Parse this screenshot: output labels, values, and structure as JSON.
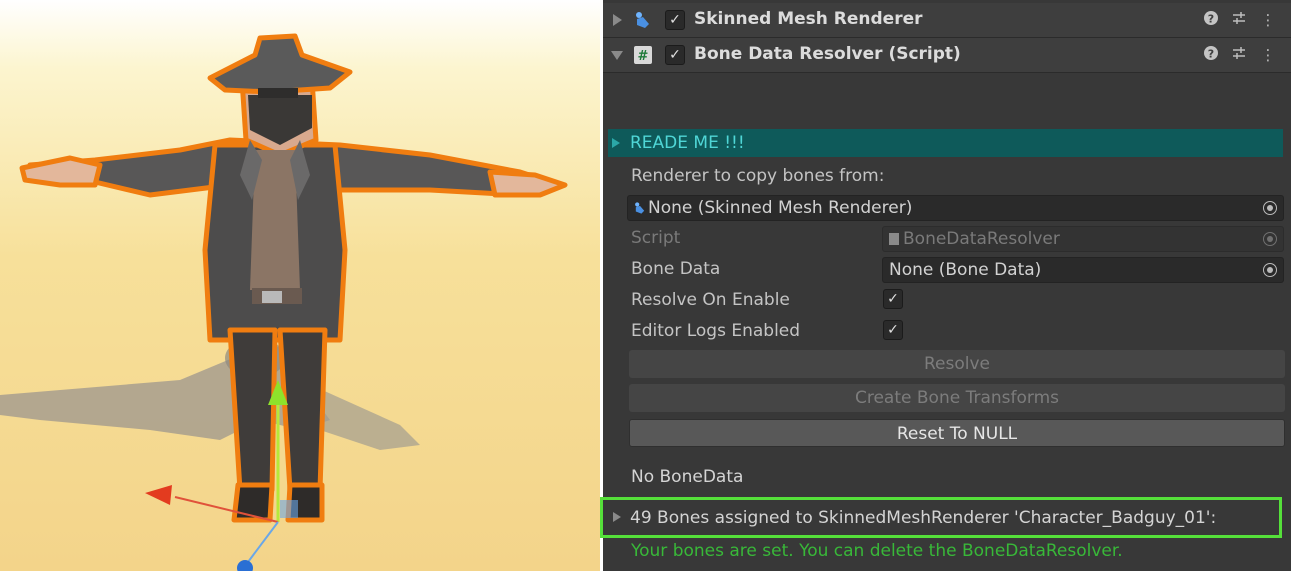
{
  "inspector": {
    "skinned_mesh_renderer": {
      "title": "Skinned Mesh Renderer"
    },
    "bone_data_resolver": {
      "title": "Bone Data Resolver (Script)"
    },
    "readme": {
      "label": "READE ME !!!"
    },
    "renderer_to_copy": {
      "label": "Renderer to copy bones from:",
      "value": "None (Skinned Mesh Renderer)"
    },
    "script": {
      "label": "Script",
      "value": "BoneDataResolver"
    },
    "bone_data": {
      "label": "Bone Data",
      "value": "None (Bone Data)"
    },
    "resolve_on_enable": {
      "label": "Resolve On Enable",
      "checked": true
    },
    "editor_logs_enabled": {
      "label": "Editor Logs Enabled",
      "checked": true
    },
    "buttons": {
      "resolve": "Resolve",
      "create_bone_transforms": "Create Bone Transforms",
      "reset_to_null": "Reset To NULL"
    },
    "status": {
      "no_bone_data": "No BoneData",
      "bones_assigned": "49 Bones assigned to SkinnedMeshRenderer 'Character_Badguy_01':",
      "success": "Your bones are set. You can delete the BoneDataResolver."
    }
  },
  "colors": {
    "readme_bar": "#0e5a5a",
    "readme_text": "#4fd6d6",
    "success_text": "#38b838",
    "highlight_border": "#55e03a",
    "selection_outline": "#f07d10"
  },
  "icons": {
    "help": "help-icon",
    "presets": "presets-icon",
    "menu": "kebab-menu-icon",
    "mesh": "skinned-mesh-icon",
    "script": "script-icon"
  }
}
